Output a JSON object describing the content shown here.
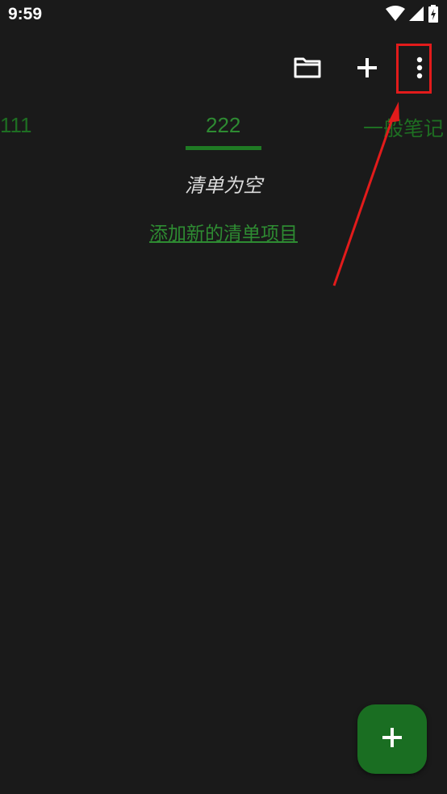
{
  "status_bar": {
    "time": "9:59",
    "icons": [
      "wifi-icon",
      "cellular-signal-icon",
      "battery-charging-icon"
    ]
  },
  "toolbar": {
    "actions": [
      "folder-icon",
      "add-icon",
      "more-vert-icon"
    ]
  },
  "tabs": [
    {
      "label": "111",
      "active": false
    },
    {
      "label": "222",
      "active": true
    },
    {
      "label": "一般笔记",
      "active": false
    }
  ],
  "main": {
    "empty_message": "清单为空",
    "add_item_link": "添加新的清单项目"
  },
  "fab": {
    "icon": "add-icon"
  },
  "colors": {
    "background": "#1a1a1a",
    "accent": "#2e8b32",
    "fab": "#1a6e22",
    "annotation": "#e21b1b"
  }
}
